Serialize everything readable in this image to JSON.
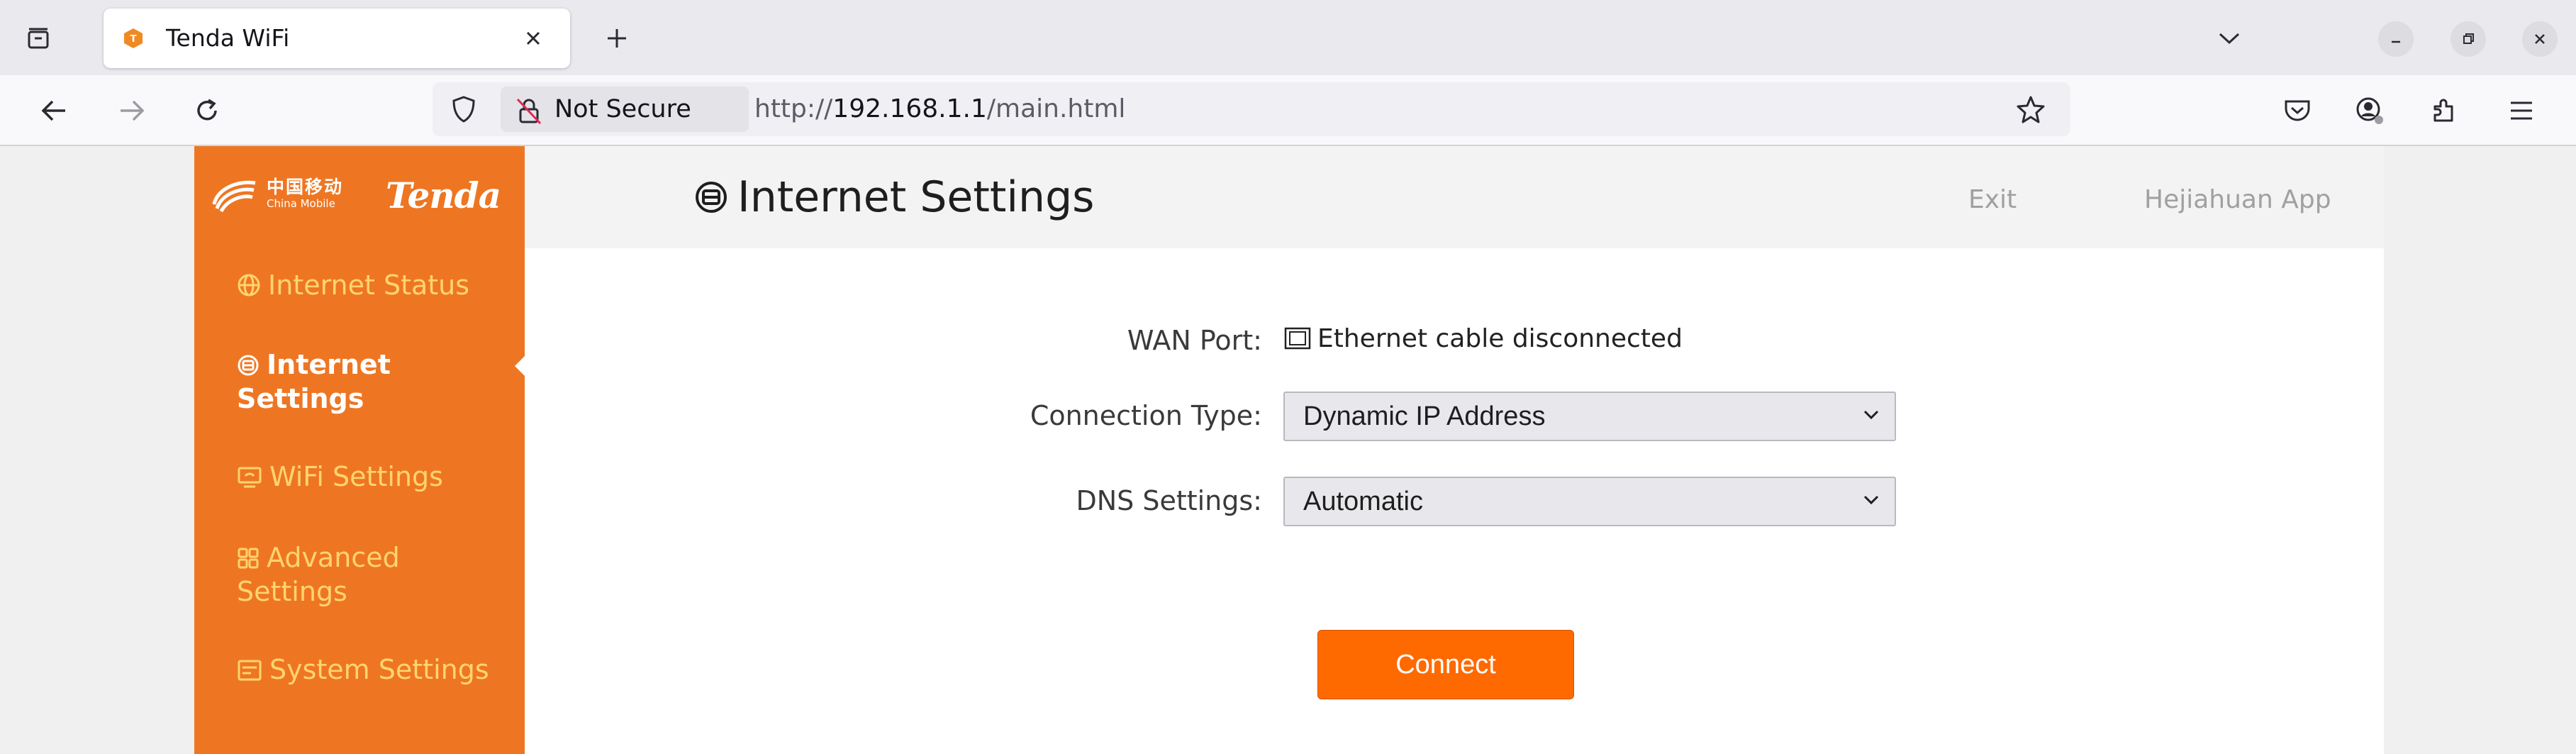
{
  "browser": {
    "tab": {
      "title": "Tenda WiFi",
      "favicon": "tenda-favicon-icon"
    },
    "toolbar": {
      "security_label": "Not Secure",
      "url_scheme": "http://",
      "url_host": "192.168.1.1",
      "url_path": "/main.html"
    }
  },
  "sidebar": {
    "brand": {
      "cn": "中国移动",
      "en": "China Mobile",
      "name": "Tenda"
    },
    "items": [
      {
        "label": "Internet Status",
        "icon": "globe-icon",
        "active": false
      },
      {
        "label": "Internet Settings",
        "icon": "internet-settings-icon",
        "active": true
      },
      {
        "label": "WiFi Settings",
        "icon": "wifi-settings-icon",
        "active": false
      },
      {
        "label": "Advanced Settings",
        "icon": "grid-icon",
        "active": false
      },
      {
        "label": "System Settings",
        "icon": "system-settings-icon",
        "active": false
      }
    ]
  },
  "header": {
    "title": "Internet Settings",
    "exit": "Exit",
    "app": "Hejiahuan App"
  },
  "form": {
    "wan_label": "WAN Port:",
    "wan_status": "Ethernet cable disconnected",
    "connection_label": "Connection Type:",
    "connection_value": "Dynamic IP Address",
    "dns_label": "DNS Settings:",
    "dns_value": "Automatic",
    "connect_label": "Connect"
  },
  "colors": {
    "sidebar": "#ee7623",
    "sidebar_inactive_text": "#ffd46e",
    "connect_button": "#ff6a00"
  }
}
